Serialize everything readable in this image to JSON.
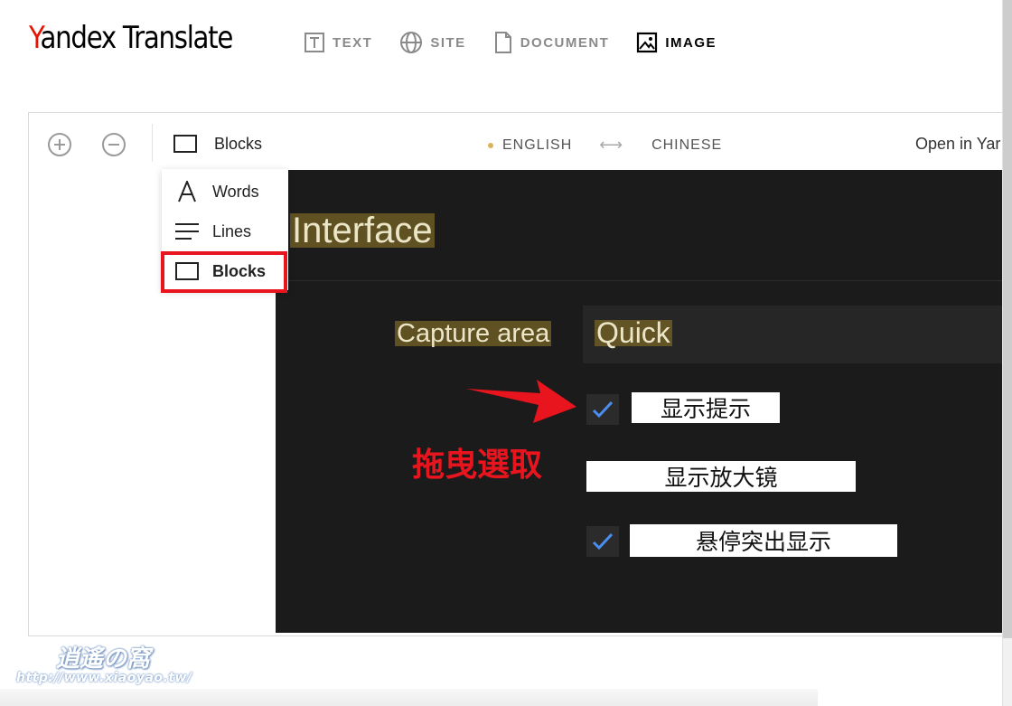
{
  "header": {
    "logo_first": "Y",
    "logo_rest": "andex Translate",
    "nav": [
      {
        "label": "TEXT",
        "icon": "text-icon",
        "active": false
      },
      {
        "label": "SITE",
        "icon": "globe-icon",
        "active": false
      },
      {
        "label": "DOCUMENT",
        "icon": "document-icon",
        "active": false
      },
      {
        "label": "IMAGE",
        "icon": "image-icon",
        "active": true
      }
    ]
  },
  "toolbar": {
    "zoom_in_icon": "plus-circle-icon",
    "zoom_out_icon": "minus-circle-icon",
    "mode_label": "Blocks",
    "source_lang": "ENGLISH",
    "swap_symbol": "⟷",
    "target_lang": "CHINESE",
    "open_in": "Open in Yar"
  },
  "mode_menu": {
    "items": [
      {
        "label": "Words",
        "icon": "letter-a-icon"
      },
      {
        "label": "Lines",
        "icon": "lines-icon"
      },
      {
        "label": "Blocks",
        "icon": "square-icon",
        "selected": true
      }
    ]
  },
  "image_content": {
    "heading": "Interface",
    "capture_label": "Capture area",
    "capture_value": "Quick",
    "options": [
      {
        "label": "显示提示",
        "checked": true
      },
      {
        "label": "显示放大镜",
        "checked": false
      },
      {
        "label": "悬停突出显示",
        "checked": true
      }
    ]
  },
  "annotation": {
    "text": "拖曳選取",
    "color": "#e8141e"
  },
  "watermark": {
    "logo": "逍遙の窩",
    "url": "http://www.xiaoyao.tw/"
  },
  "colors": {
    "brand_red": "#e61400",
    "highlight_bg": "#786426",
    "dark_bg": "#1b1b1b",
    "check_blue": "#4a8ef0"
  }
}
